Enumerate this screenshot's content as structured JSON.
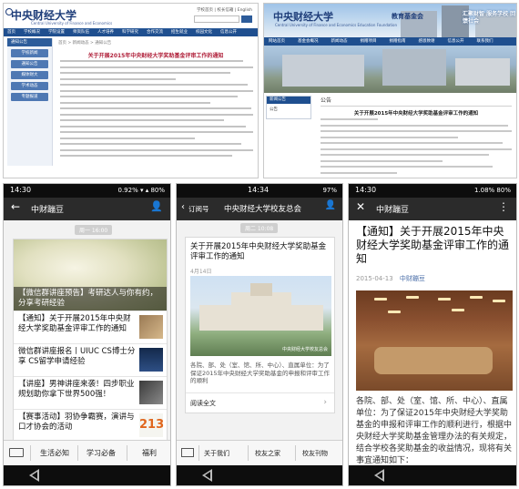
{
  "web1": {
    "logo": "中央财经大学",
    "logo_sub": "Central University of Finance and Economics",
    "top_links": "学校首页 | 校长信箱 | English",
    "nav": [
      "首页",
      "学校概况",
      "学院设置",
      "师资队伍",
      "人才培养",
      "科学研究",
      "合作交流",
      "招生就业",
      "校园文化",
      "信息公开"
    ],
    "breadcrumb": "首页 > 新闻动态 > 通知公告",
    "side_header": "通知公告",
    "side_items": [
      "学校新闻",
      "通知公告",
      "媒体财大",
      "学术动态",
      "专题报道"
    ],
    "article_title": "关于开展2015年中央财经大学奖助基金评审工作的通知"
  },
  "web2": {
    "logo": "中央财经大学",
    "logo_suffix": "教育基金会",
    "logo_sub": "Central University of Finance and Economics Education Foundation",
    "slogan": "汇聚财智 服务学校 回馈社会",
    "nav": [
      "网站首页",
      "基金会概况",
      "新闻动态",
      "捐赠项目",
      "捐赠指南",
      "感恩致谢",
      "信息公开",
      "联系我们"
    ],
    "side_header": "新闻公告",
    "side_item": "公告",
    "section": "公告",
    "article_title": "关于开展2015年中央财经大学奖助基金评审工作的通知"
  },
  "phone1": {
    "time": "14:30",
    "status_right": "0.92% ▾ ▴ 80%",
    "title": "中财蹦豆",
    "date": "周一 16:00",
    "hero_caption": "【微信群讲座预告】考研达人与你有约，分享考研经验",
    "items": [
      "【通知】关于开展2015年中央财经大学奖助基金评审工作的通知",
      "微信群讲座报名丨UIUC CS博士分享 CS留学申请经验",
      "【讲座】男神讲座来袭！四步职业规划助你拿下世界500强！",
      "【赛事活动】羽协争霸赛，演讲与口才协会的活动"
    ],
    "tabs": [
      "生活必知",
      "学习必备",
      "福利"
    ]
  },
  "phone2": {
    "time": "14:34",
    "status_right": "97%",
    "back_label": "订阅号",
    "title": "中央财经大学校友总会",
    "date": "周二 10:08",
    "card_title": "关于开展2015年中央财经大学奖助基金评审工作的通知",
    "card_date": "4月14日",
    "watermark": "中央财经大学校友总会",
    "summary": "各院、部、处（室、馆、所、中心）、直属单位：为了保证2015年中央财经大学奖助基金的申报和评审工作的顺利",
    "read_more": "阅读全文",
    "tabs": [
      "关于我们",
      "校友之家",
      "校友刊物"
    ]
  },
  "phone3": {
    "time": "14:30",
    "status_right": "1.08% 80%",
    "title": "中财蹦豆",
    "article_title": "【通知】关于开展2015年中央财经大学奖助基金评审工作的通知",
    "date": "2015-04-13",
    "account": "中财蹦豆",
    "body": "各院、部、处（室、馆、所、中心）、直属单位：为了保证2015年中央财经大学奖助基金的申报和评审工作的顺利进行，根据中央财经大学奖助基金管理办法的有关规定，结合学校各奖助基金的收益情况，现将有关事宜通知如下："
  }
}
